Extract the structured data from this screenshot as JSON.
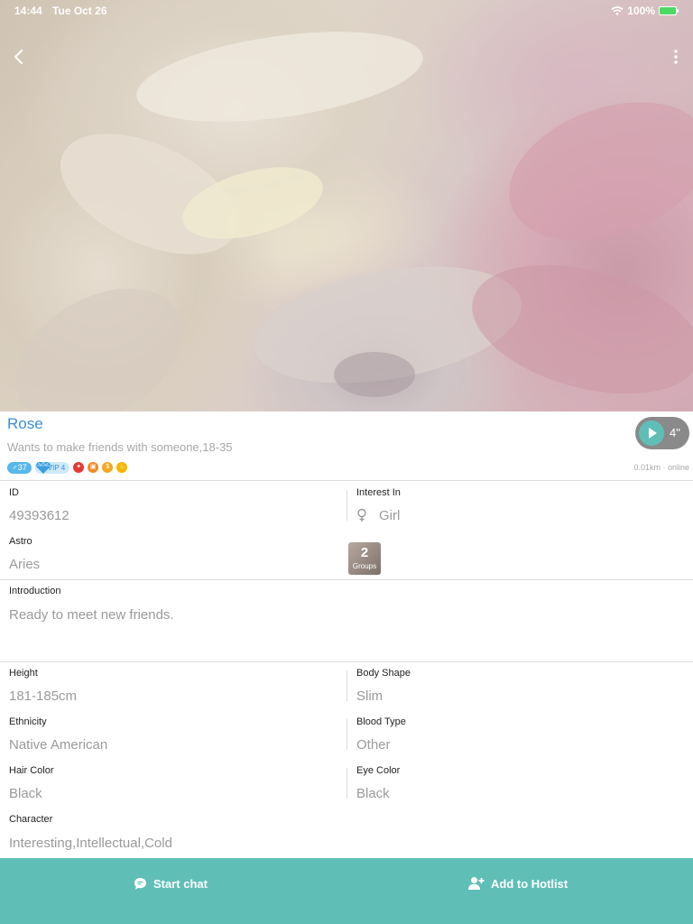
{
  "status_bar": {
    "time": "14:44",
    "date": "Tue Oct 26",
    "battery": "100%"
  },
  "profile": {
    "name": "Rose",
    "tagline": "Wants to make friends with someone,18-35",
    "age_badge": "♂37",
    "vip_badge": "VIP 4",
    "voice_duration": "4\"",
    "distance": "0.01km · online"
  },
  "details": {
    "id": {
      "label": "ID",
      "value": "49393612"
    },
    "interest_in": {
      "label": "Interest In",
      "value": "Girl"
    },
    "astro": {
      "label": "Astro",
      "value": "Aries"
    },
    "groups": {
      "count": "2",
      "label": "Groups"
    },
    "introduction": {
      "label": "Introduction",
      "value": "Ready to meet new friends."
    },
    "height": {
      "label": "Height",
      "value": "181-185cm"
    },
    "body_shape": {
      "label": "Body Shape",
      "value": "Slim"
    },
    "ethnicity": {
      "label": "Ethnicity",
      "value": "Native American"
    },
    "blood_type": {
      "label": "Blood Type",
      "value": "Other"
    },
    "hair_color": {
      "label": "Hair Color",
      "value": "Black"
    },
    "eye_color": {
      "label": "Eye Color",
      "value": "Black"
    },
    "character": {
      "label": "Character",
      "value": "Interesting,Intellectual,Cold"
    }
  },
  "actions": {
    "start_chat": "Start chat",
    "add_hotlist": "Add to Hotlist"
  },
  "colors": {
    "accent": "#5fbfb7",
    "name": "#3b8fd6",
    "value_text": "#9a9a9a"
  },
  "icons": [
    "back-chevron-icon",
    "more-vertical-icon",
    "wifi-icon",
    "battery-icon",
    "play-icon",
    "female-icon",
    "chat-bubble-icon",
    "add-user-icon",
    "diamond-icon"
  ]
}
